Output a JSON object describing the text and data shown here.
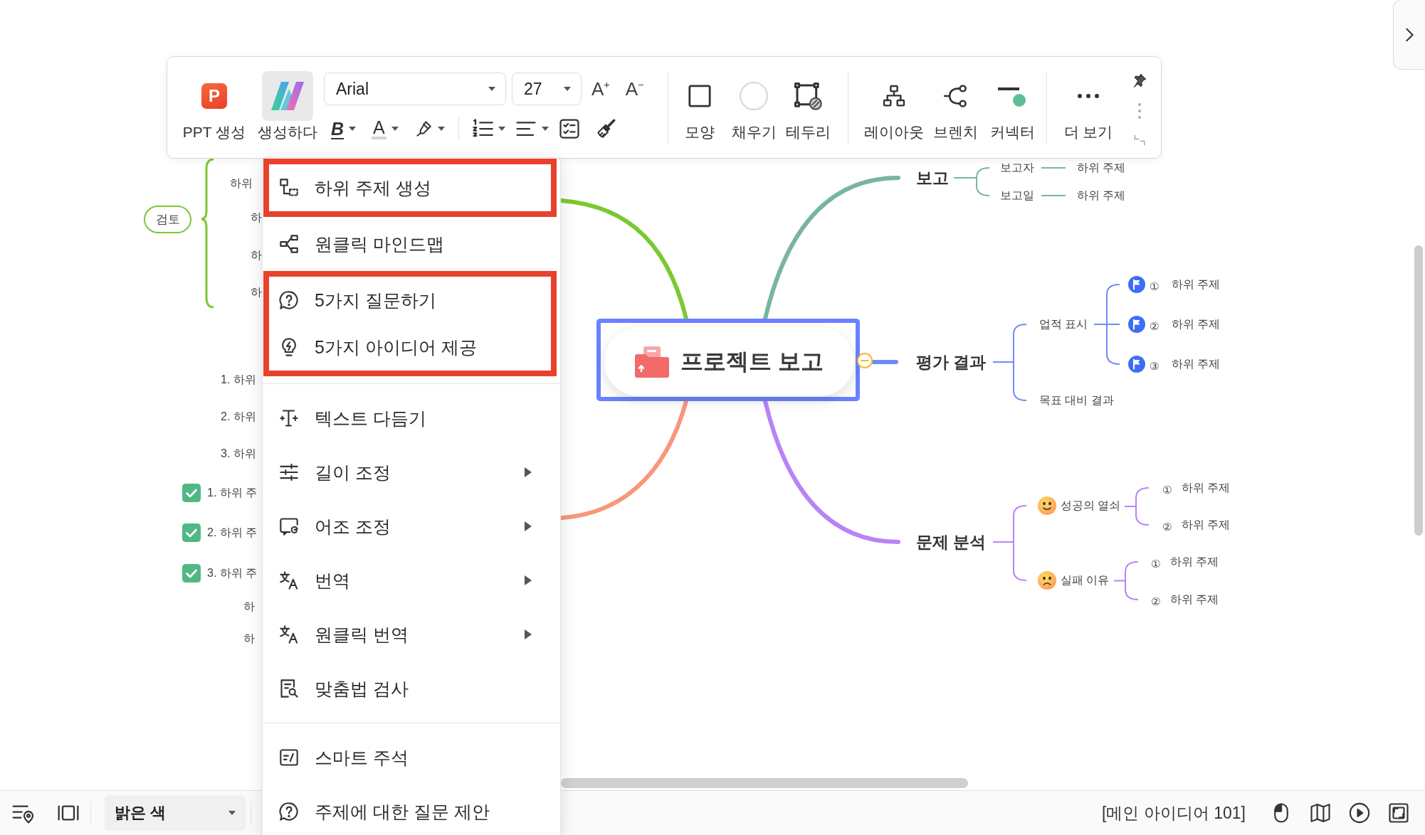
{
  "toolbar": {
    "generate_buttons": [
      {
        "kind": "ppt",
        "label": "PPT 생성",
        "icon_text": "P",
        "selected": false
      },
      {
        "kind": "ai",
        "label": "생성하다",
        "selected": true
      }
    ],
    "font_family": {
      "value": "Arial"
    },
    "font_size": {
      "value": "27"
    },
    "size_buttons": [
      "A$^{+}$",
      "A$^{−}$"
    ],
    "style_buttons": [
      {
        "kind": "bold",
        "label": "B"
      },
      {
        "kind": "font-color",
        "label": "A"
      }
    ],
    "groups": [
      {
        "items": [
          {
            "kind": "shape",
            "label": "모양"
          },
          {
            "kind": "fill",
            "label": "채우기"
          },
          {
            "kind": "border",
            "label": "테두리"
          }
        ]
      },
      {
        "items": [
          {
            "kind": "layout",
            "label": "레이아웃"
          },
          {
            "kind": "branch",
            "label": "브렌치"
          },
          {
            "kind": "connector",
            "label": "커넥터"
          }
        ]
      },
      {
        "items": [
          {
            "kind": "more",
            "label": "더 보기"
          }
        ]
      }
    ]
  },
  "context_menu": {
    "sections": [
      {
        "items": [
          {
            "kind": "subtopic",
            "label": "하위 주제 생성",
            "highlighted": true,
            "submenu": false
          },
          {
            "kind": "mindmap",
            "label": "원클릭 마인드맵",
            "highlighted": false,
            "submenu": false
          },
          {
            "kind": "question",
            "label": "5가지 질문하기",
            "highlighted": true,
            "submenu": false
          },
          {
            "kind": "idea",
            "label": "5가지 아이디어 제공",
            "highlighted": true,
            "submenu": false
          }
        ]
      },
      {
        "items": [
          {
            "kind": "polish",
            "label": "텍스트 다듬기",
            "highlighted": false,
            "submenu": false
          },
          {
            "kind": "length",
            "label": "길이 조정",
            "highlighted": false,
            "submenu": true
          },
          {
            "kind": "tone",
            "label": "어조 조정",
            "highlighted": false,
            "submenu": true
          },
          {
            "kind": "translate",
            "label": "번역",
            "highlighted": false,
            "submenu": true
          },
          {
            "kind": "translate",
            "label": "원클릭 번역",
            "highlighted": false,
            "submenu": true
          },
          {
            "kind": "spellcheck",
            "label": "맞춤법 검사",
            "highlighted": false,
            "submenu": false
          }
        ]
      },
      {
        "items": [
          {
            "kind": "note",
            "label": "스마트 주석",
            "highlighted": false,
            "submenu": false
          },
          {
            "kind": "question",
            "label": "주제에 대한 질문 제안",
            "highlighted": false,
            "submenu": false
          }
        ]
      }
    ]
  },
  "mind_map": {
    "central": {
      "label": "프로젝트 보고",
      "selected": true,
      "expanded": true
    },
    "left_branches": [
      {
        "color": "#7cc832",
        "children": [
          {
            "label": "검토",
            "children": [
              {
                "label": "하위"
              },
              {
                "label": "하"
              },
              {
                "label": "하"
              },
              {
                "label": "하"
              }
            ]
          }
        ]
      },
      {
        "color": "#f9967b",
        "children": [
          {
            "kind": "topic",
            "label": "1. 하위"
          },
          {
            "kind": "topic",
            "label": "2. 하위"
          },
          {
            "kind": "topic",
            "label": "3. 하위"
          },
          {
            "kind": "task",
            "label": "1. 하위 주",
            "checked": true
          },
          {
            "kind": "task",
            "label": "2. 하위 주",
            "checked": true
          },
          {
            "kind": "task",
            "label": "3. 하위 주",
            "checked": true
          },
          {
            "kind": "topic",
            "label": "하"
          },
          {
            "kind": "topic",
            "label": "하"
          }
        ]
      }
    ],
    "right_branches": [
      {
        "color": "#78b69c",
        "label": "보고",
        "children": [
          {
            "label": "보고자",
            "children": [
              {
                "label": "하위 주제"
              }
            ]
          },
          {
            "label": "보고일",
            "children": [
              {
                "label": "하위 주제"
              }
            ]
          }
        ]
      },
      {
        "color": "#6e8bf7",
        "label": "평가 결과",
        "children": [
          {
            "label": "업적 표시",
            "children": [
              {
                "flag": true,
                "marker": "①",
                "label": "하위 주제"
              },
              {
                "flag": true,
                "marker": "②",
                "label": "하위 주제"
              },
              {
                "flag": true,
                "marker": "③",
                "label": "하위 주제"
              }
            ]
          },
          {
            "label": "목표 대비 결과"
          }
        ]
      },
      {
        "color": "#b883f7",
        "label": "문제 분석",
        "children": [
          {
            "kind": "happy",
            "label": "성공의 열쇠",
            "children": [
              {
                "marker": "①",
                "label": "하위 주제"
              },
              {
                "marker": "②",
                "label": "하위 주제"
              }
            ]
          },
          {
            "kind": "sad",
            "label": "실패 이유",
            "children": [
              {
                "marker": "①",
                "label": "하위 주제"
              },
              {
                "marker": "②",
                "label": "하위 주제"
              }
            ]
          }
        ]
      }
    ]
  },
  "status_bar": {
    "theme": {
      "value": "밝은 색"
    },
    "topic_count": "[메인 아이디어 101]"
  }
}
